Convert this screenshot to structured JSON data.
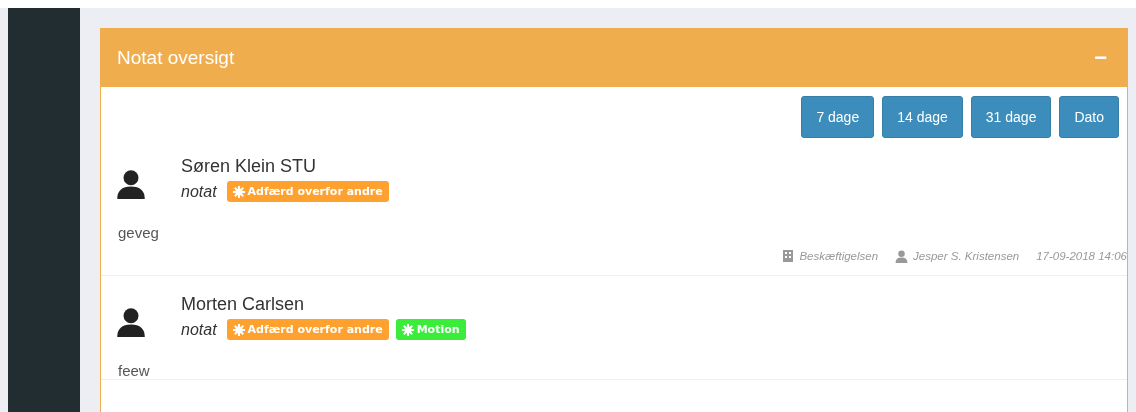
{
  "panel": {
    "title": "Notat oversigt",
    "collapse_symbol": "−"
  },
  "filters": [
    {
      "label": "7 dage"
    },
    {
      "label": "14 dage"
    },
    {
      "label": "31 dage"
    },
    {
      "label": "Dato"
    }
  ],
  "notes": [
    {
      "name": "Søren Klein STU",
      "type": "notat",
      "tags": [
        {
          "label": "Adfærd overfor andre",
          "color": "#ffa12e"
        }
      ],
      "text": "geveg",
      "department": "Beskæftigelsen",
      "author": "Jesper S. Kristensen",
      "time": "17-09-2018 14:06"
    },
    {
      "name": "Morten Carlsen",
      "type": "notat",
      "tags": [
        {
          "label": "Adfærd overfor andre",
          "color": "#ffa12e"
        },
        {
          "label": "Motion",
          "color": "#3bec3b"
        }
      ],
      "text": "feew"
    }
  ]
}
